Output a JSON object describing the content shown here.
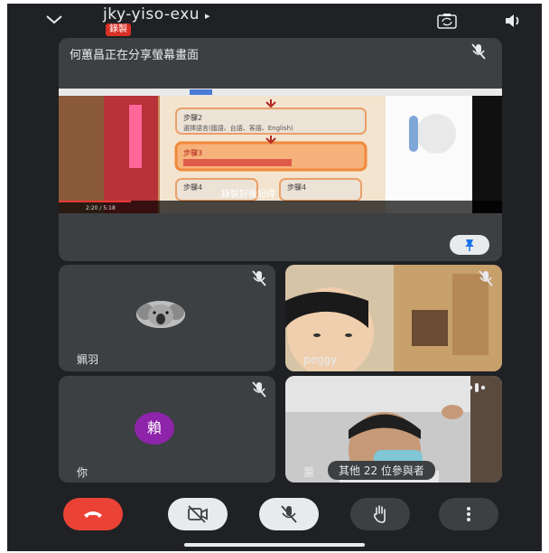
{
  "meeting": {
    "code": "jky-yiso-exu",
    "code_arrow": "▸",
    "recording_badge": "錄製"
  },
  "topbar": {
    "collapse_icon": "chevron-down-icon",
    "camera_switch_icon": "camera-switch-icon",
    "speaker_icon": "speaker-icon"
  },
  "presentation": {
    "label": "何蕙昌正在分享螢幕畫面",
    "screen": {
      "step2": "步驟2",
      "step2_text": "選擇語言(國語、台語、客語、English)",
      "step3": "步驟3",
      "step4a": "步驟4",
      "step4b": "步驟4",
      "time": "2:20 / 5:18",
      "subtitle": "錄製好後記得"
    },
    "pin_icon": "pin-icon"
  },
  "participants": [
    {
      "name": "姵羽",
      "avatar": "koala-photo",
      "muted": true
    },
    {
      "name": "peggy",
      "avatar": "camera-video",
      "muted": true
    },
    {
      "name": "你",
      "initial": "賴",
      "avatar_color": "#8e24aa",
      "muted": true
    },
    {
      "name": "蕙",
      "avatar": "camera-video",
      "speaking": true
    }
  ],
  "others_label": "其他 22 位參與者",
  "controls": {
    "end_call_icon": "end-call-icon",
    "camera_off_icon": "camera-off-icon",
    "mic_off_icon": "mic-off-icon",
    "raise_hand_icon": "raise-hand-icon",
    "more_icon": "more-vertical-icon"
  },
  "colors": {
    "background": "#202124",
    "tile": "#3c4043",
    "end_call": "#ea4335",
    "recording": "#d93025",
    "avatar_purple": "#8e24aa"
  }
}
